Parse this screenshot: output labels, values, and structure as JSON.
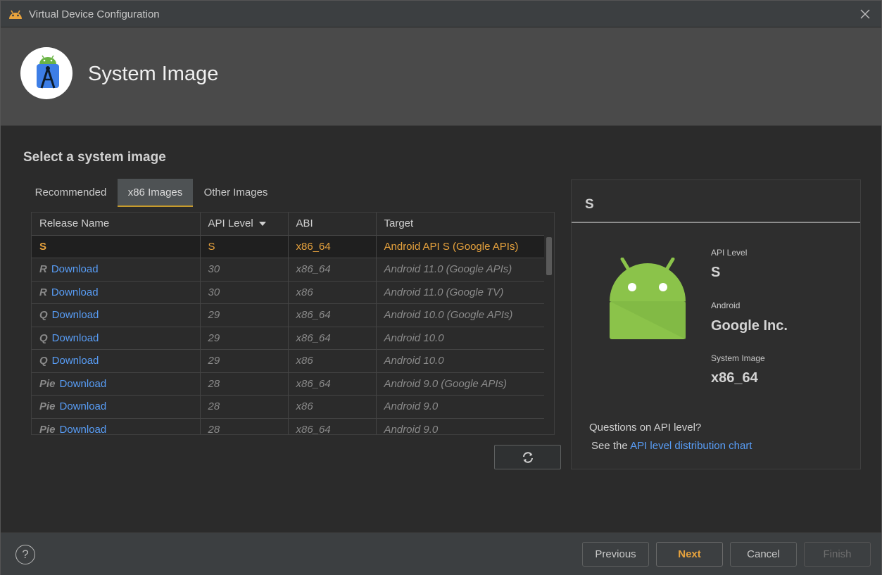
{
  "window": {
    "title": "Virtual Device Configuration"
  },
  "banner": {
    "heading": "System Image"
  },
  "section_title": "Select a system image",
  "tabs": [
    {
      "label": "Recommended",
      "active": false
    },
    {
      "label": "x86 Images",
      "active": true
    },
    {
      "label": "Other Images",
      "active": false
    }
  ],
  "table": {
    "headers": [
      "Release Name",
      "API Level",
      "ABI",
      "Target"
    ],
    "sort_column": "API Level",
    "rows": [
      {
        "code": "S",
        "download": "",
        "api": "S",
        "abi": "x86_64",
        "target": "Android API S (Google APIs)",
        "selected": true
      },
      {
        "code": "R",
        "download": "Download",
        "api": "30",
        "abi": "x86_64",
        "target": "Android 11.0 (Google APIs)",
        "selected": false
      },
      {
        "code": "R",
        "download": "Download",
        "api": "30",
        "abi": "x86",
        "target": "Android 11.0 (Google TV)",
        "selected": false
      },
      {
        "code": "Q",
        "download": "Download",
        "api": "29",
        "abi": "x86_64",
        "target": "Android 10.0 (Google APIs)",
        "selected": false
      },
      {
        "code": "Q",
        "download": "Download",
        "api": "29",
        "abi": "x86_64",
        "target": "Android 10.0",
        "selected": false
      },
      {
        "code": "Q",
        "download": "Download",
        "api": "29",
        "abi": "x86",
        "target": "Android 10.0",
        "selected": false
      },
      {
        "code": "Pie",
        "download": "Download",
        "api": "28",
        "abi": "x86_64",
        "target": "Android 9.0 (Google APIs)",
        "selected": false
      },
      {
        "code": "Pie",
        "download": "Download",
        "api": "28",
        "abi": "x86",
        "target": "Android 9.0",
        "selected": false
      },
      {
        "code": "Pie",
        "download": "Download",
        "api": "28",
        "abi": "x86_64",
        "target": "Android 9.0",
        "selected": false
      }
    ]
  },
  "refresh_icon": "refresh-icon",
  "detail": {
    "title": "S",
    "api_level_label": "API Level",
    "api_level_value": "S",
    "vendor_label": "Android",
    "vendor_value": "Google Inc.",
    "system_image_label": "System Image",
    "system_image_value": "x86_64",
    "question": "Questions on API level?",
    "see_prefix": "See the ",
    "link_text": "API level distribution chart"
  },
  "footer": {
    "help": "?",
    "previous": "Previous",
    "next": "Next",
    "cancel": "Cancel",
    "finish": "Finish"
  },
  "colors": {
    "accent": "#e8a33d",
    "link": "#589df6",
    "android_green": "#8bc34a",
    "background": "#2b2b2b"
  }
}
